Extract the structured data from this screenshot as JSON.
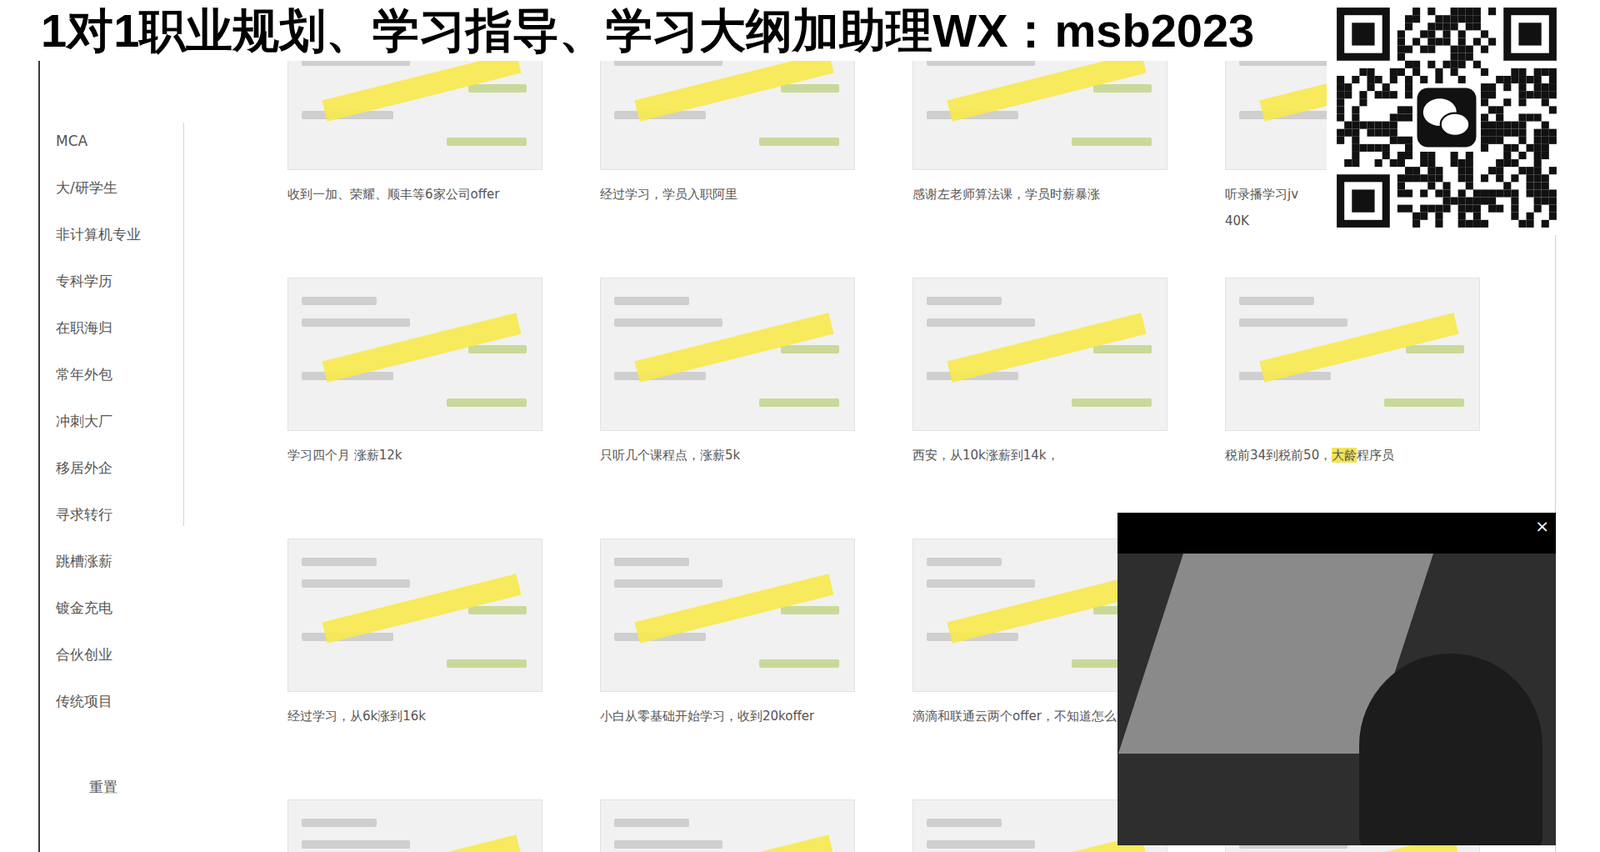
{
  "banner": {
    "text": "1对1职业规划、学习指导、学习大纲加助理WX：msb2023"
  },
  "sidebar": {
    "items": [
      {
        "label": "MCA",
        "selected": false
      },
      {
        "label": "大/研学生",
        "selected": false
      },
      {
        "label": "非计算机专业",
        "selected": false
      },
      {
        "label": "专科学历",
        "selected": false
      },
      {
        "label": "在职海归",
        "selected": false
      },
      {
        "label": "常年外包",
        "selected": false
      },
      {
        "label": "冲刺大厂",
        "selected": false
      },
      {
        "label": "移居外企",
        "selected": false
      },
      {
        "label": "寻求转行",
        "selected": false
      },
      {
        "label": "跳槽涨薪",
        "selected": false
      },
      {
        "label": "镀金充电",
        "selected": false
      },
      {
        "label": "合伙创业",
        "selected": false
      },
      {
        "label": "传统项目",
        "selected": false
      }
    ],
    "reset": "重置"
  },
  "cards": [
    {
      "caption": [
        [
          {
            "text": "收到一加、荣耀、顺丰等6家公司offer",
            "marked": false
          }
        ]
      ]
    },
    {
      "caption": [
        [
          {
            "text": "经过学习，学员入职阿里",
            "marked": false
          }
        ]
      ]
    },
    {
      "caption": [
        [
          {
            "text": "感谢左老师算法课，学员时薪暴涨",
            "marked": false
          }
        ]
      ]
    },
    {
      "caption": [
        [
          {
            "text": "听录播学习jv",
            "marked": false
          }
        ],
        [
          {
            "text": "40K",
            "marked": false
          }
        ]
      ]
    },
    {
      "caption": [
        [
          {
            "text": "学习四个月 涨薪12k",
            "marked": false
          }
        ]
      ]
    },
    {
      "caption": [
        [
          {
            "text": "只听几个课程点，涨薪5k",
            "marked": false
          }
        ]
      ]
    },
    {
      "caption": [
        [
          {
            "text": "西安，从10k涨薪到14k，",
            "marked": false
          }
        ]
      ]
    },
    {
      "caption": [
        [
          {
            "text": "税前34到税前50，",
            "marked": false
          },
          {
            "text": "大龄",
            "marked": true
          },
          {
            "text": "程序员",
            "marked": false
          }
        ]
      ]
    },
    {
      "caption": [
        [
          {
            "text": "经过学习，从6k涨到16k",
            "marked": false
          }
        ]
      ]
    },
    {
      "caption": [
        [
          {
            "text": "小白从零基础开始学习，收到20koffer",
            "marked": false
          }
        ]
      ]
    },
    {
      "caption": [
        [
          {
            "text": "滴滴和联通云两个offer，不知道怎么",
            "marked": false
          }
        ]
      ]
    },
    {
      "caption": []
    },
    {
      "caption": []
    },
    {
      "caption": []
    },
    {
      "caption": []
    },
    {
      "caption": []
    }
  ],
  "video": {
    "close": "×"
  }
}
